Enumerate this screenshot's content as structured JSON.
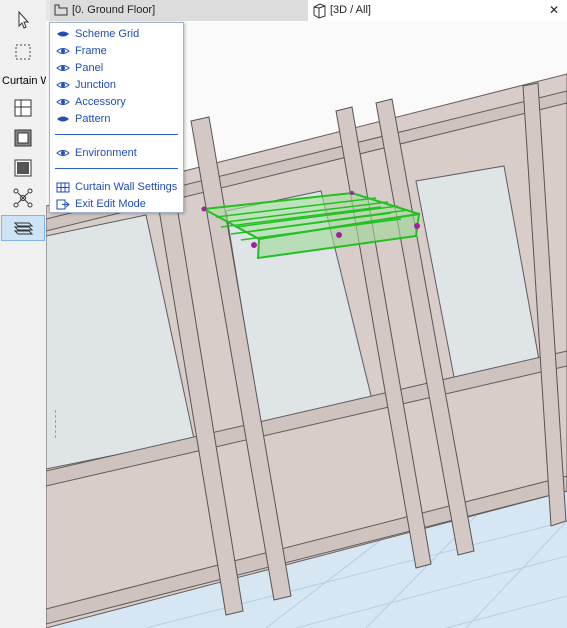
{
  "toolbar": {
    "label": "Curtain W",
    "tools": [
      {
        "name": "arrow-tool",
        "icon": "arrow-cursor-icon"
      },
      {
        "name": "marquee-tool",
        "icon": "marquee-icon"
      },
      {
        "name": "scheme-grid-tool",
        "icon": "grid-icon"
      },
      {
        "name": "frame-tool",
        "icon": "frame-icon"
      },
      {
        "name": "panel-tool",
        "icon": "panel-icon"
      },
      {
        "name": "junction-tool",
        "icon": "junction-icon"
      },
      {
        "name": "accessory-tool",
        "icon": "accessory-icon"
      }
    ]
  },
  "tabs": [
    {
      "label": "[0. Ground Floor]",
      "icon": "floor-plan-icon"
    },
    {
      "label": "[3D / All]",
      "icon": "3d-box-icon"
    }
  ],
  "tab_close": "✕",
  "menu": {
    "items": [
      {
        "label": "Scheme Grid",
        "icon": "closed-eye-icon"
      },
      {
        "label": "Frame",
        "icon": "eye-icon"
      },
      {
        "label": "Panel",
        "icon": "eye-icon"
      },
      {
        "label": "Junction",
        "icon": "eye-icon"
      },
      {
        "label": "Accessory",
        "icon": "eye-icon"
      },
      {
        "label": "Pattern",
        "icon": "closed-eye-icon"
      },
      {
        "label": "Environment",
        "icon": "eye-icon"
      },
      {
        "label": "Curtain Wall Settings",
        "icon": "settings-grid-icon"
      },
      {
        "label": "Exit Edit Mode",
        "icon": "exit-icon"
      }
    ]
  },
  "colors": {
    "menu_text": "#1f4eb4",
    "selection_green": "#22c022",
    "wall": "#d9cdca",
    "glass": "#dfe5e6",
    "floor": "#d7e6f3",
    "hotspot": "#a020a0"
  }
}
